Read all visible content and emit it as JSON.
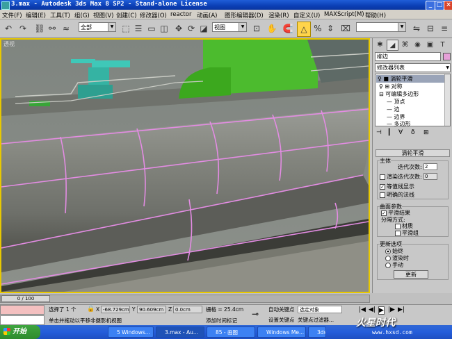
{
  "window": {
    "title": "3.max - Autodesk 3ds Max 8 SP2 - Stand-alone License",
    "min": "_",
    "max": "□",
    "close": "×"
  },
  "menubar": [
    "文件(F)",
    "编辑(E)",
    "工具(T)",
    "组(G)",
    "视图(V)",
    "创建(C)",
    "修改器(O)",
    "reactor",
    "动画(A)",
    "图形编辑器(D)",
    "渲染(R)",
    "自定义(U)",
    "MAXScript(M)",
    "帮助(H)"
  ],
  "toolbar": {
    "selection_filter": "全部",
    "ref_coord": "视图"
  },
  "viewport": {
    "label": "透视"
  },
  "command_panel": {
    "object_name": "柳边",
    "modifier_list": "修改器列表",
    "stack": [
      {
        "label": "涡轮平滑",
        "selected": true
      },
      {
        "label": "对称",
        "selected": false
      },
      {
        "label": "可编辑多边形",
        "selected": false
      },
      {
        "label": "顶点",
        "selected": false
      },
      {
        "label": "边",
        "selected": false
      },
      {
        "label": "边界",
        "selected": false
      },
      {
        "label": "多边形",
        "selected": false
      }
    ],
    "rollout_title": "涡轮平滑",
    "main_group": "主体",
    "iterations_label": "迭代次数:",
    "iterations_value": "2",
    "render_iters_label": "渲染迭代次数:",
    "render_iters_value": "0",
    "isoline_label": "等值线显示",
    "explicit_normals_label": "明确的法线",
    "surface_group": "曲面参数",
    "smooth_result_label": "平滑结果",
    "separate_label": "分隔方式:",
    "materials_label": "材质",
    "smoothing_groups_label": "平滑组",
    "update_group": "更新选项",
    "always_label": "始终",
    "when_rendering_label": "渲染时",
    "manually_label": "手动",
    "update_button": "更新"
  },
  "timeline": {
    "frame": "0 / 100"
  },
  "statusbar": {
    "selected": "选择了 1 个",
    "prompt": "单击并拖动以平移非摄影机视图",
    "x_value": "-68.729cm",
    "y_value": "90.609cm",
    "z_value": "0.0cm",
    "x_label": "X",
    "y_label": "Y",
    "z_label": "Z",
    "grid": "栅格 = 25.4cm",
    "add_time_tag": "添加时间标记",
    "auto_key": "自动关键点",
    "set_key": "设置关键点",
    "selected_set": "选定对象",
    "key_filters": "关键点过滤器..."
  },
  "taskbar": {
    "start": "开始",
    "tasks": [
      "5 Windows...",
      "3.max - Au...",
      "85 - 画图",
      "Windows Me...",
      "3dsmax..."
    ],
    "watermark": "火星时代",
    "url": "www.hxsd.com"
  }
}
